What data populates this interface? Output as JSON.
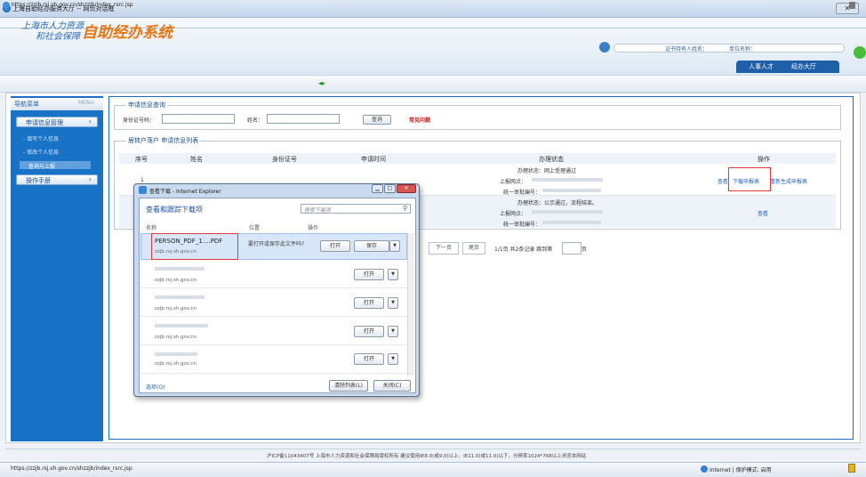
{
  "window": {
    "title": "上海自助经办服务大厅 -- 网页对话框",
    "close": "✕"
  },
  "address": {
    "url": "https://zzjb.rsj.sh.gov.cn/shzzjb/index_rsrc.jsp"
  },
  "header": {
    "logo_line1": "上海市人力资源",
    "logo_line2": "和社会保障",
    "logo_big": "自助经办系统",
    "applicant_label": "证书持有人姓名：",
    "unit_label": "单位名称：",
    "tabs": [
      "人事人才",
      "经办大厅"
    ]
  },
  "sidebar": {
    "title": "导航菜单",
    "menu": "MENU",
    "groups": [
      {
        "label": "申请信息管理",
        "items": [
          "- 填写个人信息",
          "- 修改个人信息",
          "查询与上报"
        ]
      },
      {
        "label": "操作手册",
        "items": []
      }
    ]
  },
  "query": {
    "legend": "申请信息查询",
    "id_label": "身份证号码：",
    "name_label": "姓名：",
    "button": "查询",
    "faq": "常见问题"
  },
  "list": {
    "legend": "居转户落户 申请信息列表",
    "columns": [
      "序号",
      "姓名",
      "身份证号",
      "申请时间",
      "办理状态",
      "操作"
    ],
    "rows": [
      {
        "index": "1",
        "status": [
          "办理状态：网上受理通过",
          "上报网点：",
          "统一审批编号："
        ],
        "actions": [
          "查看",
          "下载申报表",
          "重新生成申报表"
        ]
      },
      {
        "index": "",
        "status": [
          "办理状态：公示通过，流程结束。",
          "上报网点：",
          "统一审批编号："
        ],
        "actions": [
          "查看"
        ]
      }
    ],
    "pager": {
      "next": "下一页",
      "last": "尾页",
      "info": "1/1页 共2条记录 跳到第",
      "page_suffix": "页"
    }
  },
  "dialog": {
    "title": "查看下载 - Internet Explorer",
    "heading": "查看和跟踪下载项",
    "search_placeholder": "搜索下载项",
    "col_name": "名称",
    "col_location": "位置",
    "col_action": "操作",
    "items": [
      {
        "name": "PERSON_PDF_1....PDF",
        "site": "zzjb.rsj.sh.gov.cn",
        "prompt": "要打开或保存此文件吗?",
        "open": "打开",
        "save": "保存"
      },
      {
        "name": "",
        "site": "zzjb.rsj.sh.gov.cn",
        "open": "打开"
      },
      {
        "name": "",
        "site": "zzjb.rsj.sh.gov.cn",
        "open": "打开"
      },
      {
        "name": "",
        "site": "zzjb.rsj.sh.gov.cn",
        "open": "打开"
      },
      {
        "name": "",
        "site": "zzjb.rsj.sh.gov.cn",
        "open": "打开"
      }
    ],
    "options": "选项(O)",
    "clear": "清除列表(L)",
    "close": "关闭(C)"
  },
  "footer": {
    "text": "沪ICP备11043407号   上海市人力资源和社会保障局版权所有   建议使用IE8.0(或9.0)以上、IE11.0(或11.0)以下，分辨率1024*768以上浏览本网站"
  },
  "status": {
    "url": "https://zzjb.rsj.sh.gov.cn/shzzjb/index_rsrc.jsp",
    "zone": "Internet | 保护模式: 启用"
  }
}
